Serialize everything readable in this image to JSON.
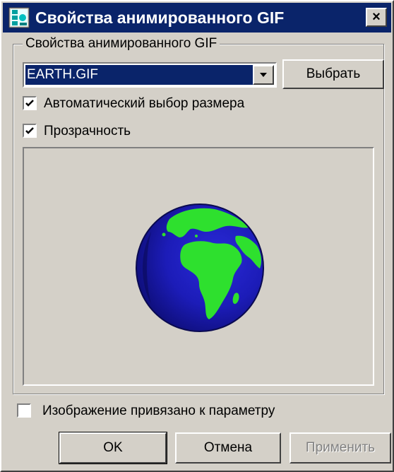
{
  "window": {
    "title": "Свойства анимированного GIF",
    "close_label": "×",
    "title_icon": "gif-app-icon"
  },
  "group": {
    "legend": "Свойства анимированного GIF"
  },
  "file_combo": {
    "value": "EARTH.GIF",
    "arrow_icon": "chevron-down-icon"
  },
  "choose_button": {
    "label": "Выбрать"
  },
  "checkboxes": {
    "auto_size": {
      "label": "Автоматический выбор размера",
      "checked": true
    },
    "transparency": {
      "label": "Прозрачность",
      "checked": true
    },
    "bound_to_param": {
      "label": "Изображение привязано к параметру",
      "checked": false
    }
  },
  "preview": {
    "image": "earth-globe-icon"
  },
  "buttons": {
    "ok": "OK",
    "cancel": "Отмена",
    "apply": "Применить",
    "apply_enabled": false
  },
  "colors": {
    "titlebar": "#0a246a",
    "face": "#d4d0c8",
    "globe_ocean": "#1c1cb8",
    "globe_land": "#2ee02e"
  }
}
